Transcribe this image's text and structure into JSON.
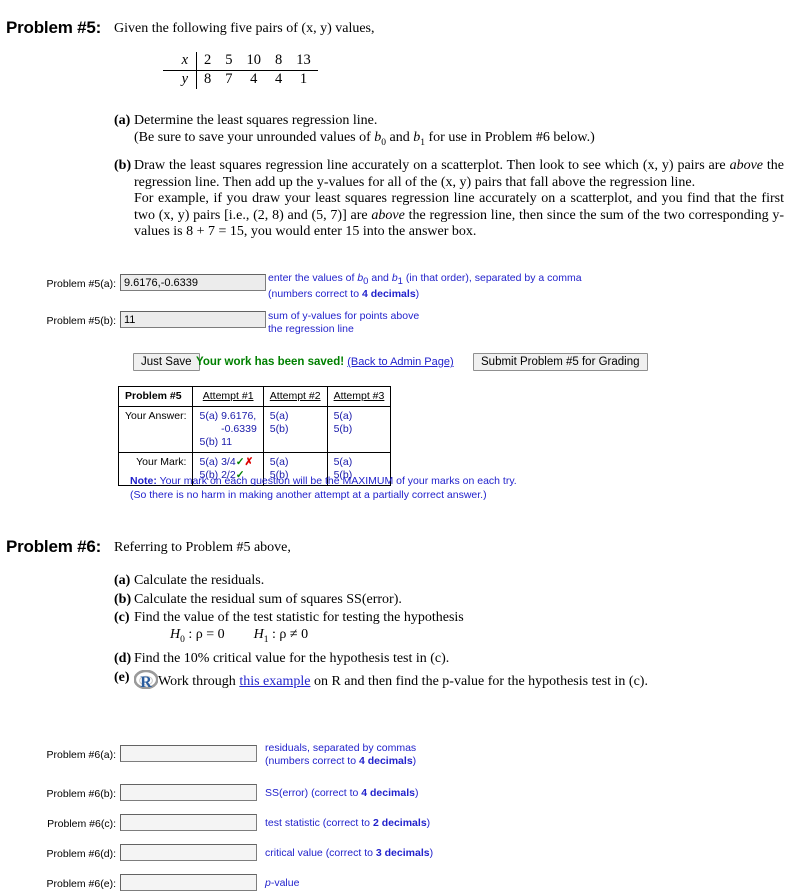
{
  "problem5": {
    "heading": "Problem #5:",
    "intro": "Given the following five pairs of (x, y) values,",
    "data_table": {
      "x_label": "x",
      "y_label": "y",
      "x_values": [
        "2",
        "5",
        "10",
        "8",
        "13"
      ],
      "y_values": [
        "8",
        "7",
        "4",
        "4",
        "1"
      ]
    },
    "parts": {
      "a_label": "(a)",
      "a_line1": "Determine the least squares regression line.",
      "a_line2_pre": "(Be sure to save your unrounded values of ",
      "a_b0": "b",
      "a_b0_sub": "0",
      "a_mid": " and ",
      "a_b1": "b",
      "a_b1_sub": "1",
      "a_line2_post": " for use in Problem #6 below.)",
      "b_label": "(b)",
      "b_text_1": "Draw the least squares regression line accurately on a scatterplot. Then look to see which (x, y) pairs are ",
      "b_above_1": "above",
      "b_text_2": " the regression line. Then add up the y-values for all of the (x, y) pairs that fall above the regression line.",
      "b_text_3": "For example, if you draw your least squares regression line accurately on a scatterplot, and you find that the first two (x, y) pairs [i.e., (2, 8) and (5, 7)] are ",
      "b_above_2": "above",
      "b_text_4": " the regression line, then since the sum of the two corresponding y-values is 8 + 7 = 15, you would enter 15 into the answer box."
    },
    "answers": [
      {
        "label": "Problem #5(a):",
        "value": "9.6176,-0.6339",
        "hint_line1_pre": "enter the values of ",
        "hint_b0": "b",
        "hint_b0_sub": "0",
        "hint_line1_mid": " and ",
        "hint_b1": "b",
        "hint_b1_sub": "1",
        "hint_line1_post": " (in that order), separated by a comma",
        "hint_line2_pre": "(numbers correct to ",
        "hint_line2_bold": "4 decimals",
        "hint_line2_post": ")"
      },
      {
        "label": "Problem #5(b):",
        "value": "11",
        "hint_line1": "sum of y-values for points above",
        "hint_line2": "the regression line"
      }
    ],
    "actions": {
      "just_save": "Just Save",
      "saved_message": "Your work has been saved!",
      "admin_link": "(Back to Admin Page)",
      "submit_button": "Submit Problem #5 for Grading"
    },
    "attempts_table": {
      "corner_header": "Problem #5",
      "columns": [
        "Attempt #1",
        "Attempt #2",
        "Attempt #3"
      ],
      "row_headers": [
        "Your Answer:",
        "Your Mark:"
      ],
      "answer_row": {
        "attempt1": {
          "a_key": "5(a)",
          "a_val_line1": "9.6176,",
          "a_val_line2": "-0.6339",
          "b_key": "5(b)",
          "b_val": "11"
        },
        "attempt2": {
          "a_key": "5(a)",
          "b_key": "5(b)"
        },
        "attempt3": {
          "a_key": "5(a)",
          "b_key": "5(b)"
        }
      },
      "mark_row": {
        "attempt1": {
          "a_key": "5(a)",
          "a_mark": "3/4",
          "a_check": "✓",
          "a_cross": "✗",
          "b_key": "5(b)",
          "b_mark": "2/2",
          "b_check": "✓"
        },
        "attempt2": {
          "a_key": "5(a)",
          "b_key": "5(b)"
        },
        "attempt3": {
          "a_key": "5(a)",
          "b_key": "5(b)"
        }
      }
    },
    "note": {
      "bold": "Note:",
      "line1": " Your mark on each question will be the MAXIMUM of your marks on each try.",
      "line2": "(So there is no harm in making another attempt at a partially correct answer.)"
    }
  },
  "problem6": {
    "heading": "Problem #6:",
    "intro": "Referring to Problem #5 above,",
    "parts": {
      "a_label": "(a)",
      "a_text": "Calculate the residuals.",
      "b_label": "(b)",
      "b_text": "Calculate the residual sum of squares SS(error).",
      "c_label": "(c)",
      "c_text": "Find the value of the test statistic for testing the hypothesis",
      "c_h0": "H",
      "c_h0_sub": "0",
      "c_h0_rest": " : ρ = 0",
      "c_h1": "H",
      "c_h1_sub": "1",
      "c_h1_rest": " : ρ ≠ 0",
      "d_label": "(d)",
      "d_text": "Find the 10% critical value for the hypothesis test in (c).",
      "e_label": "(e)",
      "e_icon": "r-logo-icon",
      "e_text_pre": "Work through ",
      "e_link": "this example",
      "e_text_post": " on R and then find the p-value for the hypothesis test in (c)."
    },
    "answers": [
      {
        "label": "Problem #6(a):",
        "value": "",
        "hint_line1": "residuals, separated by commas",
        "hint_line2_pre": "(numbers correct to ",
        "hint_line2_bold": "4 decimals",
        "hint_line2_post": ")"
      },
      {
        "label": "Problem #6(b):",
        "value": "",
        "hint_line1_pre": "SS(error) (correct to ",
        "hint_line1_bold": "4 decimals",
        "hint_line1_post": ")"
      },
      {
        "label": "Problem #6(c):",
        "value": "",
        "hint_line1_pre": "test statistic (correct to ",
        "hint_line1_bold": "2 decimals",
        "hint_line1_post": ")"
      },
      {
        "label": "Problem #6(d):",
        "value": "",
        "hint_line1_pre": "critical value (correct to ",
        "hint_line1_bold": "3 decimals",
        "hint_line1_post": ")"
      },
      {
        "label": "Problem #6(e):",
        "value": "",
        "hint_line1": "p-value"
      }
    ]
  },
  "colors": {
    "hint_blue": "#2222cc",
    "saved_green": "#008000",
    "check_green": "#008000",
    "cross_red": "#dd0000",
    "r_logo_blue": "#2b5d9e",
    "r_logo_gray": "#9a9a9a"
  }
}
